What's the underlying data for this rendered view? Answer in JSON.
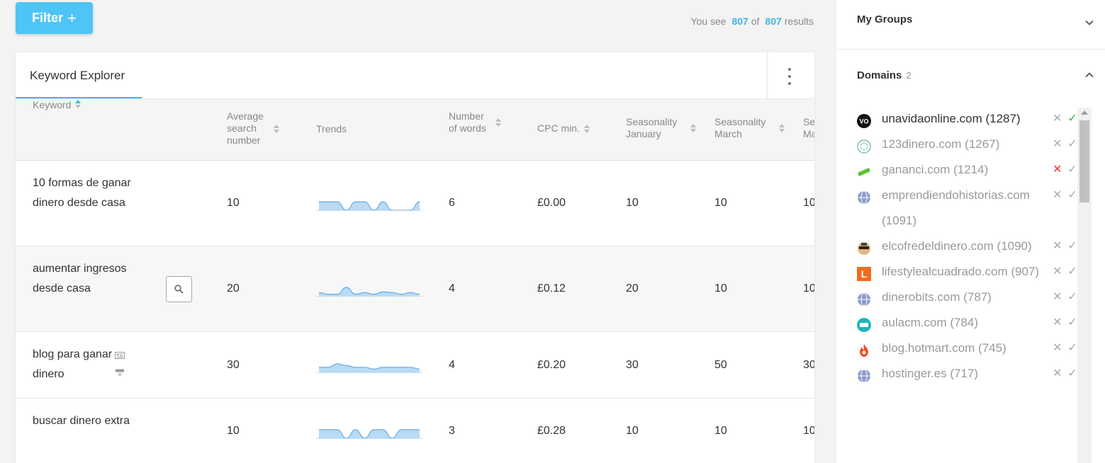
{
  "toolbar": {
    "filter_label": "Filter",
    "filter_plus": "+"
  },
  "results": {
    "prefix": "You see",
    "shown": "807",
    "of": "of",
    "total": "807",
    "suffix": "results"
  },
  "card": {
    "tab_title": "Keyword Explorer"
  },
  "columns": {
    "keyword": "Keyword",
    "avg_search": "Average search number",
    "trends": "Trends",
    "num_words": "Number of words",
    "cpc_min": "CPC min.",
    "season_jan": "Seasonality January",
    "season_mar": "Seasonality March",
    "season_next": "Se Ma"
  },
  "rows": [
    {
      "keyword": "10 formas de ganar dinero desde casa",
      "avg": "10",
      "words": "6",
      "cpc": "£0.00",
      "jan": "10",
      "mar": "10",
      "next": "10",
      "trend": [
        10,
        10,
        10,
        0,
        10,
        10,
        0,
        10,
        0,
        0,
        0,
        10
      ]
    },
    {
      "keyword": "aumentar ingresos desde casa",
      "avg": "20",
      "words": "4",
      "cpc": "£0.12",
      "jan": "20",
      "mar": "10",
      "next": "10",
      "trend": [
        10,
        5,
        5,
        25,
        5,
        10,
        5,
        12,
        10,
        5,
        10,
        5
      ]
    },
    {
      "keyword": "blog para ganar dinero",
      "avg": "30",
      "words": "4",
      "cpc": "£0.20",
      "jan": "30",
      "mar": "50",
      "next": "30",
      "trend": [
        30,
        30,
        50,
        40,
        30,
        30,
        20,
        30,
        30,
        30,
        30,
        20
      ]
    },
    {
      "keyword": "buscar dinero extra",
      "avg": "10",
      "words": "3",
      "cpc": "£0.28",
      "jan": "10",
      "mar": "10",
      "next": "10",
      "trend": [
        10,
        10,
        10,
        0,
        10,
        0,
        10,
        10,
        0,
        10,
        10,
        10
      ]
    }
  ],
  "sidebar": {
    "groups_title": "My Groups",
    "domains_title": "Domains",
    "domains_count": "2",
    "domains": [
      {
        "name": "unavidaonline.com (1287)",
        "icon": "vo-logo-icon",
        "state": "enabled"
      },
      {
        "name": "123dinero.com (1267)",
        "icon": "circle-logo-icon",
        "state": "disabled"
      },
      {
        "name": "gananci.com (1214)",
        "icon": "green-banner-icon",
        "state": "excluded"
      },
      {
        "name": "emprendiendohistorias.com (1091)",
        "icon": "globe-icon",
        "state": "disabled"
      },
      {
        "name": "elcofredeldinero.com (1090)",
        "icon": "bandit-icon",
        "state": "disabled"
      },
      {
        "name": "lifestylealcuadrado.com (907)",
        "icon": "l-logo-icon",
        "state": "disabled"
      },
      {
        "name": "dinerobits.com (787)",
        "icon": "globe-icon",
        "state": "disabled"
      },
      {
        "name": "aulacm.com (784)",
        "icon": "aula-logo-icon",
        "state": "disabled"
      },
      {
        "name": "blog.hotmart.com (745)",
        "icon": "flame-icon",
        "state": "disabled"
      },
      {
        "name": "hostinger.es (717)",
        "icon": "globe-icon",
        "state": "disabled"
      }
    ]
  },
  "colors": {
    "accent": "#3fb5ec",
    "filter_button": "#4ec5f6",
    "chart_fill": "#b9dbf5",
    "chart_stroke": "#6aa9e0",
    "check_green": "#3cb54a",
    "cross_red": "#e53935"
  }
}
